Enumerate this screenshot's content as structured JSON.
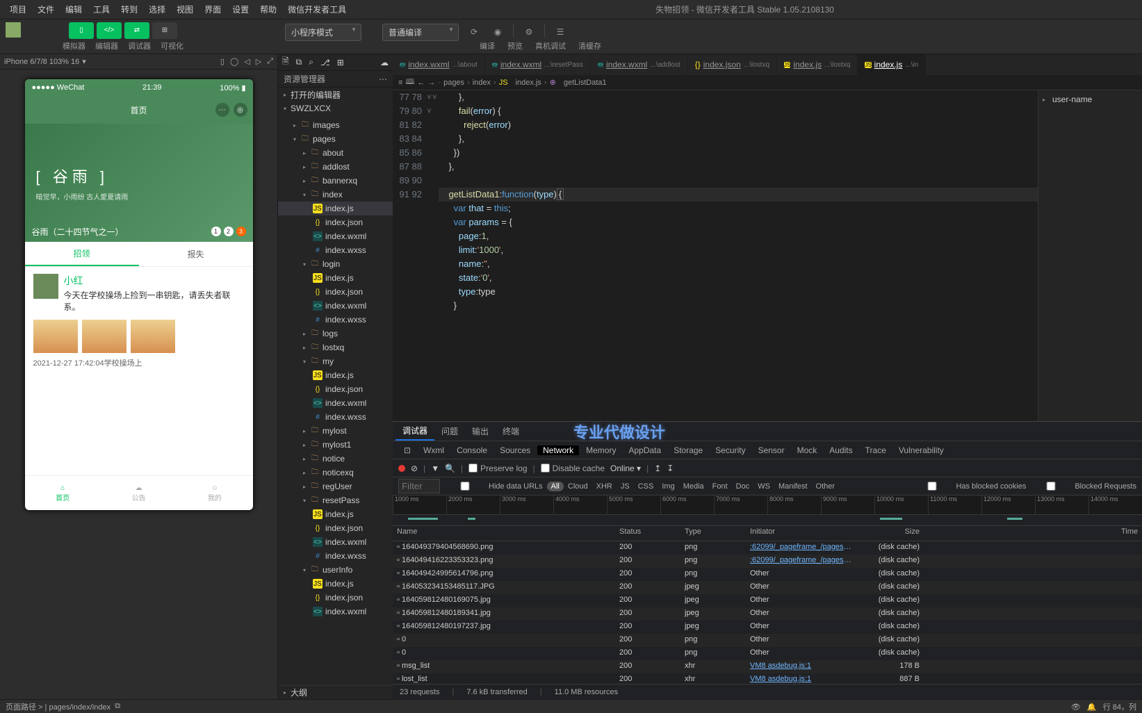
{
  "menubar": {
    "items": [
      "项目",
      "文件",
      "编辑",
      "工具",
      "转到",
      "选择",
      "视图",
      "界面",
      "设置",
      "帮助",
      "微信开发者工具"
    ],
    "title": "失物招领 - 微信开发者工具 Stable 1.05.2108130"
  },
  "toolbar": {
    "mode_buttons": [
      "模拟器",
      "编辑器",
      "调试器",
      "可视化"
    ],
    "select_mode": "小程序模式",
    "select_compile": "普通编译",
    "right_labels": [
      "编译",
      "预览",
      "真机调试",
      "清缓存"
    ]
  },
  "simulator": {
    "device": "iPhone 6/7/8 103% 16",
    "status": {
      "left": "●●●●● WeChat",
      "center": "21:39",
      "right": "100% ▮"
    },
    "page_title": "首页",
    "hero": {
      "t1": "[ 谷雨 ]",
      "t2": "暗觉早，小雨纷\n古人愛夏请雨",
      "t3": "谷雨（二十四节气之一）",
      "dots": [
        "1",
        "2",
        "3"
      ]
    },
    "tabs": [
      "招领",
      "报失"
    ],
    "post": {
      "name": "小红",
      "text": "今天在学校操场上捡到一串钥匙，请丢失者联系。",
      "meta": "2021-12-27 17:42:04学校操场上"
    },
    "tabbar": [
      "首页",
      "公告",
      "我的"
    ]
  },
  "explorer": {
    "title": "资源管理器",
    "sections": [
      "打开的编辑器",
      "SWZLXCX"
    ],
    "tree": [
      {
        "l": 1,
        "t": "folder",
        "n": "images",
        "open": false
      },
      {
        "l": 1,
        "t": "folder",
        "n": "pages",
        "open": true
      },
      {
        "l": 2,
        "t": "folder",
        "n": "about",
        "open": false
      },
      {
        "l": 2,
        "t": "folder",
        "n": "addlost",
        "open": false
      },
      {
        "l": 2,
        "t": "folder",
        "n": "bannerxq",
        "open": false
      },
      {
        "l": 2,
        "t": "folder",
        "n": "index",
        "open": true
      },
      {
        "l": 3,
        "t": "js",
        "n": "index.js",
        "sel": true
      },
      {
        "l": 3,
        "t": "json",
        "n": "index.json"
      },
      {
        "l": 3,
        "t": "wxml",
        "n": "index.wxml"
      },
      {
        "l": 3,
        "t": "wxss",
        "n": "index.wxss"
      },
      {
        "l": 2,
        "t": "folder",
        "n": "login",
        "open": true
      },
      {
        "l": 3,
        "t": "js",
        "n": "index.js"
      },
      {
        "l": 3,
        "t": "json",
        "n": "index.json"
      },
      {
        "l": 3,
        "t": "wxml",
        "n": "index.wxml"
      },
      {
        "l": 3,
        "t": "wxss",
        "n": "index.wxss"
      },
      {
        "l": 2,
        "t": "folder",
        "n": "logs",
        "open": false
      },
      {
        "l": 2,
        "t": "folder",
        "n": "lostxq",
        "open": false
      },
      {
        "l": 2,
        "t": "folder",
        "n": "my",
        "open": true
      },
      {
        "l": 3,
        "t": "js",
        "n": "index.js"
      },
      {
        "l": 3,
        "t": "json",
        "n": "index.json"
      },
      {
        "l": 3,
        "t": "wxml",
        "n": "index.wxml"
      },
      {
        "l": 3,
        "t": "wxss",
        "n": "index.wxss"
      },
      {
        "l": 2,
        "t": "folder",
        "n": "mylost",
        "open": false
      },
      {
        "l": 2,
        "t": "folder",
        "n": "mylost1",
        "open": false
      },
      {
        "l": 2,
        "t": "folder",
        "n": "notice",
        "open": false
      },
      {
        "l": 2,
        "t": "folder",
        "n": "noticexq",
        "open": false
      },
      {
        "l": 2,
        "t": "folder",
        "n": "regUser",
        "open": false
      },
      {
        "l": 2,
        "t": "folder",
        "n": "resetPass",
        "open": true
      },
      {
        "l": 3,
        "t": "js",
        "n": "index.js"
      },
      {
        "l": 3,
        "t": "json",
        "n": "index.json"
      },
      {
        "l": 3,
        "t": "wxml",
        "n": "index.wxml"
      },
      {
        "l": 3,
        "t": "wxss",
        "n": "index.wxss"
      },
      {
        "l": 2,
        "t": "folder",
        "n": "userInfo",
        "open": true
      },
      {
        "l": 3,
        "t": "js",
        "n": "index.js"
      },
      {
        "l": 3,
        "t": "json",
        "n": "index.json"
      },
      {
        "l": 3,
        "t": "wxml",
        "n": "index.wxml"
      }
    ],
    "outline": "大纲"
  },
  "tabs": [
    {
      "ic": "wxml",
      "fn": "index.wxml",
      "pth": "...\\about"
    },
    {
      "ic": "wxml",
      "fn": "index.wxml",
      "pth": "...\\resetPass"
    },
    {
      "ic": "wxml",
      "fn": "index.wxml",
      "pth": "...\\addlost"
    },
    {
      "ic": "json",
      "fn": "index.json",
      "pth": "...\\lostxq"
    },
    {
      "ic": "js",
      "fn": "index.js",
      "pth": "...\\lostxq"
    },
    {
      "ic": "js",
      "fn": "index.js",
      "pth": "...\\in",
      "act": true
    }
  ],
  "breadcrumb": [
    "pages",
    "index",
    "index.js",
    "getListData1"
  ],
  "outline_item": "user-name",
  "code": {
    "start": 77,
    "lines": [
      "        },",
      "        fail(error) {",
      "          reject(error)",
      "        },",
      "      })",
      "    },",
      "",
      "    getListData1:function(type){",
      "      var that = this;",
      "      var params = {",
      "        page:1,",
      "        limit:'1000',",
      "        name:'',",
      "        state:'0',",
      "        type:type",
      "      }"
    ],
    "folds": {
      "78": "v",
      "84": "v",
      "86": "v"
    }
  },
  "devtools": {
    "top_tabs": [
      "调试器",
      "问题",
      "输出",
      "终端"
    ],
    "watermark": "专业代做设计",
    "panels": [
      "Wxml",
      "Console",
      "Sources",
      "Network",
      "Memory",
      "AppData",
      "Storage",
      "Security",
      "Sensor",
      "Mock",
      "Audits",
      "Trace",
      "Vulnerability"
    ],
    "panel_active": "Network",
    "controls": {
      "preserve": "Preserve log",
      "disable": "Disable cache",
      "online": "Online"
    },
    "filter": {
      "placeholder": "Filter",
      "hide": "Hide data URLs",
      "types": [
        "All",
        "Cloud",
        "XHR",
        "JS",
        "CSS",
        "Img",
        "Media",
        "Font",
        "Doc",
        "WS",
        "Manifest",
        "Other"
      ],
      "blocked_cookies": "Has blocked cookies",
      "blocked_req": "Blocked Requests"
    },
    "timeline": [
      "1000 ms",
      "2000 ms",
      "3000 ms",
      "4000 ms",
      "5000 ms",
      "6000 ms",
      "7000 ms",
      "8000 ms",
      "9000 ms",
      "10000 ms",
      "11000 ms",
      "12000 ms",
      "13000 ms",
      "14000 ms"
    ],
    "columns": [
      "Name",
      "Status",
      "Type",
      "Initiator",
      "Size",
      "Time"
    ],
    "rows": [
      {
        "n": "164049379404568690.png",
        "s": "200",
        "t": "png",
        "i": ":62099/_pageframe_/pages/in...",
        "sz": "(disk cache)",
        "lnk": true
      },
      {
        "n": "164049416223353323.png",
        "s": "200",
        "t": "png",
        "i": ":62099/_pageframe_/pages/in...",
        "sz": "(disk cache)",
        "lnk": true
      },
      {
        "n": "164049424995614796.png",
        "s": "200",
        "t": "png",
        "i": "Other",
        "sz": "(disk cache)"
      },
      {
        "n": "164053234153485117.JPG",
        "s": "200",
        "t": "jpeg",
        "i": "Other",
        "sz": "(disk cache)"
      },
      {
        "n": "164059812480169075.jpg",
        "s": "200",
        "t": "jpeg",
        "i": "Other",
        "sz": "(disk cache)"
      },
      {
        "n": "164059812480189341.jpg",
        "s": "200",
        "t": "jpeg",
        "i": "Other",
        "sz": "(disk cache)"
      },
      {
        "n": "164059812480197237.jpg",
        "s": "200",
        "t": "jpeg",
        "i": "Other",
        "sz": "(disk cache)"
      },
      {
        "n": "0",
        "s": "200",
        "t": "png",
        "i": "Other",
        "sz": "(disk cache)"
      },
      {
        "n": "0",
        "s": "200",
        "t": "png",
        "i": "Other",
        "sz": "(disk cache)"
      },
      {
        "n": "msg_list",
        "s": "200",
        "t": "xhr",
        "i": "VM8 asdebug.js:1",
        "sz": "178 B",
        "lnk": true
      },
      {
        "n": "lost_list",
        "s": "200",
        "t": "xhr",
        "i": "VM8 asdebug.js:1",
        "sz": "887 B",
        "lnk": true
      }
    ],
    "footer": [
      "23 requests",
      "7.6 kB transferred",
      "11.0 MB resources"
    ]
  },
  "statusbar": {
    "left": "页面路径 >  | pages/index/index",
    "right": "行 84，列"
  }
}
